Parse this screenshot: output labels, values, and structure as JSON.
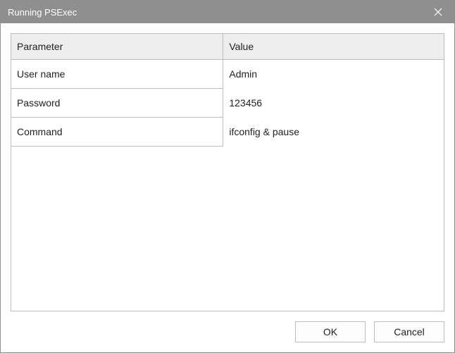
{
  "window": {
    "title": "Running PSExec"
  },
  "table": {
    "headers": {
      "parameter": "Parameter",
      "value": "Value"
    },
    "rows": [
      {
        "param": "User name",
        "value": "Admin"
      },
      {
        "param": "Password",
        "value": "123456"
      },
      {
        "param": "Command",
        "value": "ifconfig & pause"
      }
    ]
  },
  "buttons": {
    "ok": "OK",
    "cancel": "Cancel"
  }
}
